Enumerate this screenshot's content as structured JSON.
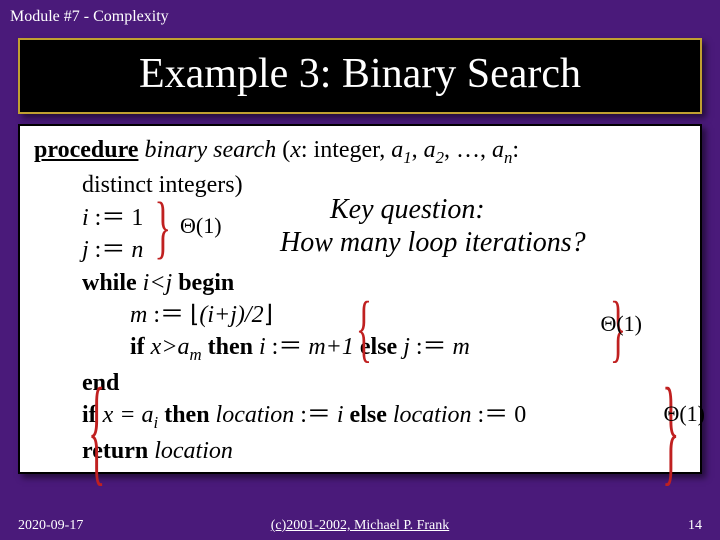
{
  "header": "Module #7 - Complexity",
  "title": "Example 3: Binary Search",
  "proc": {
    "kw_procedure": "procedure",
    "name": " binary search",
    "sig_open": " (",
    "x": "x",
    "sig_mid": ": integer, ",
    "a": "a",
    "sig_sep": ", ",
    "dots": ", …, ",
    "sig_close": ":",
    "line2": "distinct integers)",
    "i": "i",
    "assign": " :＝ ",
    "one": "1",
    "j": "j",
    "n": "n",
    "kw_while": "while",
    "ltj": " i<j ",
    "kw_begin": "begin",
    "m": "m",
    "floor_open": "⌊",
    "ij2": "(i+j)/2",
    "floor_close": "⌋",
    "kw_if": "if",
    "cond": " x>a",
    "msub": "m",
    "kw_then": " then ",
    "mplus1": "m+1",
    "kw_else": " else ",
    "kw_end": "end",
    "cond2": " x = a",
    "isub": "i",
    "loc": "location",
    "zero": "0",
    "kw_return": "return "
  },
  "annot": {
    "theta": "Θ(1)",
    "keyq": "Key question:",
    "howmany": "How many loop iterations?"
  },
  "footer": {
    "left": "2020-09-17",
    "center": "(c)2001-2002, Michael P. Frank",
    "right": "14"
  }
}
